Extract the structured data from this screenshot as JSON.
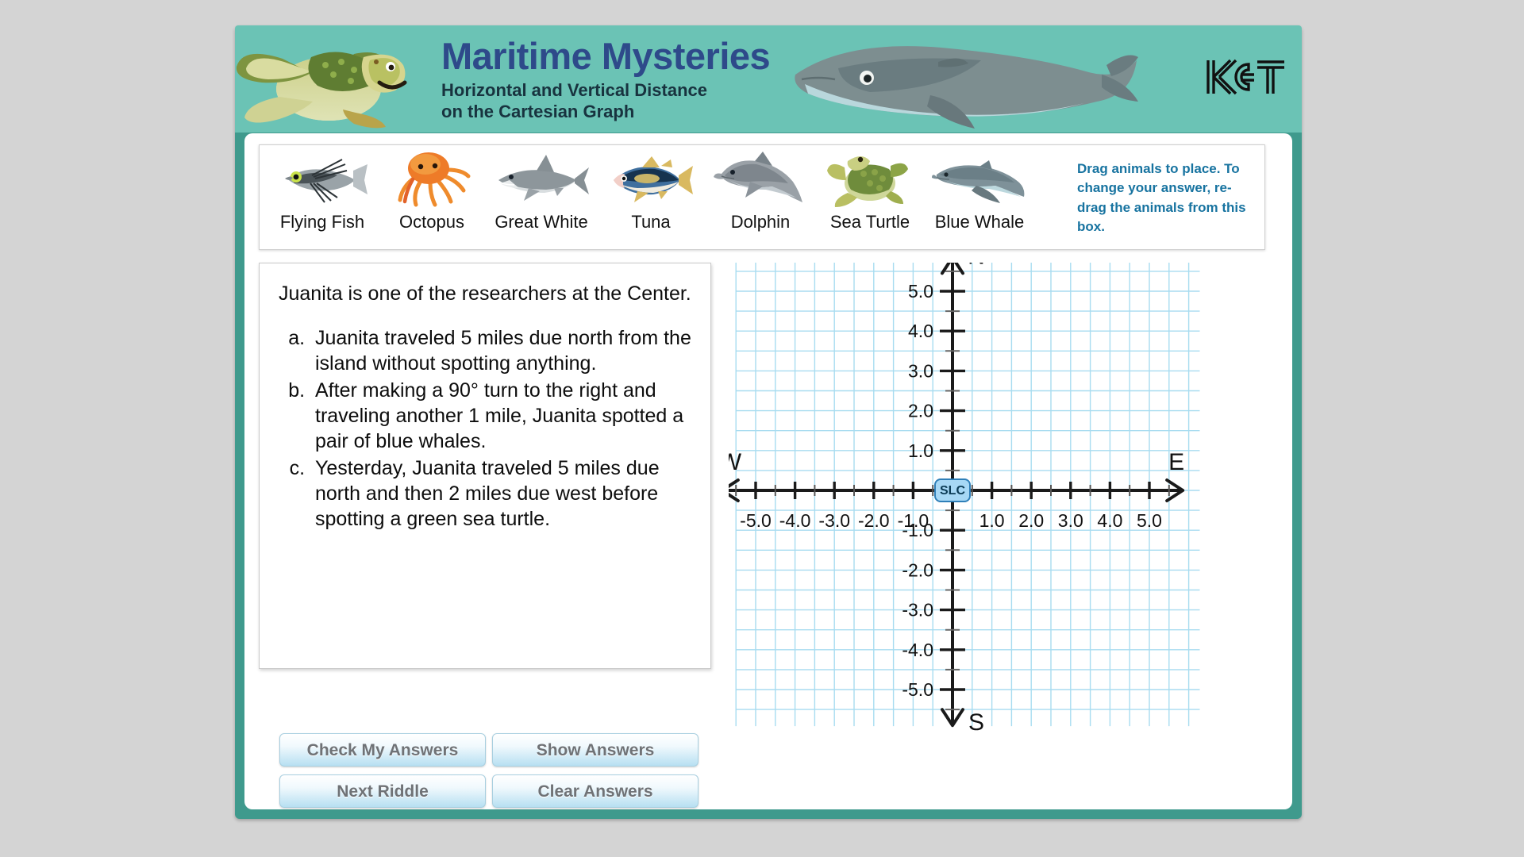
{
  "header": {
    "title": "Maritime Mysteries",
    "subtitle_line1": "Horizontal and Vertical Distance",
    "subtitle_line2": "on the Cartesian Graph",
    "logo": "KET",
    "banner_color": "#6bc3b5",
    "title_color": "#2e4a8a",
    "subtitle_color": "#18333f"
  },
  "tray": {
    "animals": [
      {
        "label": "Flying Fish",
        "icon": "flying-fish-icon"
      },
      {
        "label": "Octopus",
        "icon": "octopus-icon"
      },
      {
        "label": "Great White",
        "icon": "great-white-shark-icon"
      },
      {
        "label": "Tuna",
        "icon": "tuna-icon"
      },
      {
        "label": "Dolphin",
        "icon": "dolphin-icon"
      },
      {
        "label": "Sea Turtle",
        "icon": "sea-turtle-icon"
      },
      {
        "label": "Blue Whale",
        "icon": "blue-whale-icon"
      }
    ],
    "instructions": "Drag animals to place. To change your answer, re-drag the animals from this box.",
    "instructions_color": "#1773a0"
  },
  "question": {
    "intro": "Juanita is one of the researchers at the Center.",
    "items": [
      {
        "marker": "a.",
        "text": "Juanita traveled 5 miles due north from the island without spotting anything."
      },
      {
        "marker": "b.",
        "text": "After making a 90° turn to the right and traveling another 1 mile, Juanita spotted a pair of blue whales."
      },
      {
        "marker": "c.",
        "text": "Yesterday, Juanita traveled 5 miles due north and then 2 miles due west before spotting a green sea turtle."
      }
    ]
  },
  "buttons": {
    "check": "Check My Answers",
    "show": "Show Answers",
    "next": "Next Riddle",
    "clear": "Clear Answers"
  },
  "chart_data": {
    "type": "scatter",
    "title": "",
    "xlabel": "",
    "ylabel": "",
    "xlim": [
      -5.8,
      5.8
    ],
    "ylim": [
      -5.8,
      5.8
    ],
    "grid": true,
    "grid_color": "#a8dcf0",
    "major_step": 1.0,
    "minor_step": 0.5,
    "x_ticks": [
      -5.0,
      -4.0,
      -3.0,
      -2.0,
      -1.0,
      1.0,
      2.0,
      3.0,
      4.0,
      5.0
    ],
    "x_tick_labels": [
      "-5.0",
      "-4.0",
      "-3.0",
      "-2.0",
      "-1.0",
      "1.0",
      "2.0",
      "3.0",
      "4.0",
      "5.0"
    ],
    "y_ticks": [
      5.0,
      4.0,
      3.0,
      2.0,
      1.0,
      -1.0,
      -2.0,
      -3.0,
      -4.0,
      -5.0
    ],
    "y_tick_labels": [
      "5.0",
      "4.0",
      "3.0",
      "2.0",
      "1.0",
      "-1.0",
      "-2.0",
      "-3.0",
      "-4.0",
      "-5.0"
    ],
    "axis_direction_labels": {
      "north": "N",
      "south": "S",
      "east": "E",
      "west": "W"
    },
    "origin_marker": {
      "label": "SLC",
      "x": 0,
      "y": 0,
      "fill": "#a7d8f5",
      "stroke": "#2f7fb8"
    },
    "series": [],
    "values": []
  }
}
